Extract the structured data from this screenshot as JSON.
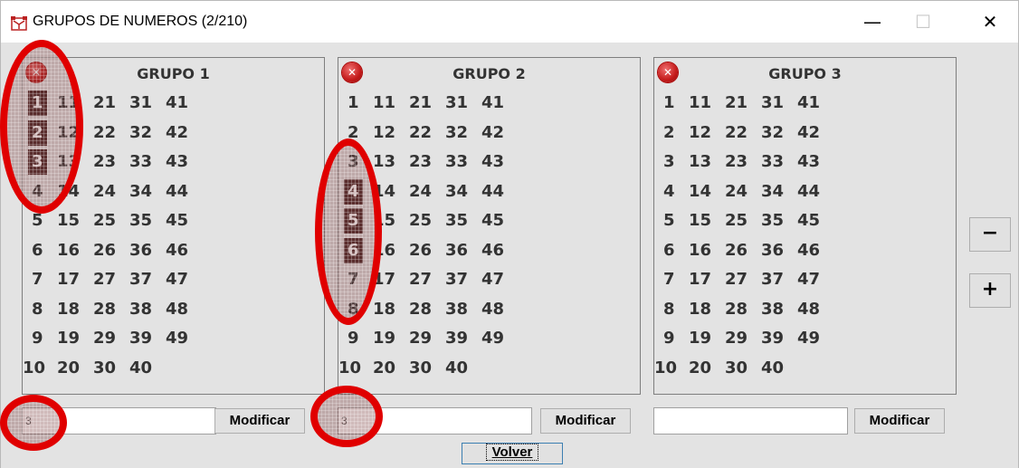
{
  "window": {
    "title": "GRUPOS DE NUMEROS (2/210)",
    "minimize": "—",
    "maximize": "☐",
    "close": "✕"
  },
  "groups": [
    {
      "title": "GRUPO 1",
      "rows": [
        [
          "1",
          "11",
          "21",
          "31",
          "41"
        ],
        [
          "2",
          "12",
          "22",
          "32",
          "42"
        ],
        [
          "3",
          "13",
          "23",
          "33",
          "43"
        ],
        [
          "4",
          "14",
          "24",
          "34",
          "44"
        ],
        [
          "5",
          "15",
          "25",
          "35",
          "45"
        ],
        [
          "6",
          "16",
          "26",
          "36",
          "46"
        ],
        [
          "7",
          "17",
          "27",
          "37",
          "47"
        ],
        [
          "8",
          "18",
          "28",
          "38",
          "48"
        ],
        [
          "9",
          "19",
          "29",
          "39",
          "49"
        ],
        [
          "10",
          "20",
          "30",
          "40"
        ]
      ],
      "selected": [
        "1",
        "2",
        "3"
      ],
      "input_value": "3",
      "button": "Modificar"
    },
    {
      "title": "GRUPO 2",
      "rows": [
        [
          "1",
          "11",
          "21",
          "31",
          "41"
        ],
        [
          "2",
          "12",
          "22",
          "32",
          "42"
        ],
        [
          "3",
          "13",
          "23",
          "33",
          "43"
        ],
        [
          "4",
          "14",
          "24",
          "34",
          "44"
        ],
        [
          "5",
          "15",
          "25",
          "35",
          "45"
        ],
        [
          "6",
          "16",
          "26",
          "36",
          "46"
        ],
        [
          "7",
          "17",
          "27",
          "37",
          "47"
        ],
        [
          "8",
          "18",
          "28",
          "38",
          "48"
        ],
        [
          "9",
          "19",
          "29",
          "39",
          "49"
        ],
        [
          "10",
          "20",
          "30",
          "40"
        ]
      ],
      "selected": [
        "4",
        "5",
        "6"
      ],
      "input_value": "3",
      "button": "Modificar"
    },
    {
      "title": "GRUPO 3",
      "rows": [
        [
          "1",
          "11",
          "21",
          "31",
          "41"
        ],
        [
          "2",
          "12",
          "22",
          "32",
          "42"
        ],
        [
          "3",
          "13",
          "23",
          "33",
          "43"
        ],
        [
          "4",
          "14",
          "24",
          "34",
          "44"
        ],
        [
          "5",
          "15",
          "25",
          "35",
          "45"
        ],
        [
          "6",
          "16",
          "26",
          "36",
          "46"
        ],
        [
          "7",
          "17",
          "27",
          "37",
          "47"
        ],
        [
          "8",
          "18",
          "28",
          "38",
          "48"
        ],
        [
          "9",
          "19",
          "29",
          "39",
          "49"
        ],
        [
          "10",
          "20",
          "30",
          "40"
        ]
      ],
      "selected": [],
      "input_value": "",
      "button": "Modificar"
    }
  ],
  "side_buttons": {
    "minus": "−",
    "plus": "+"
  },
  "volver": "Volver",
  "colors": {
    "selected_bg": "#4a2525",
    "annotation": "#e00000",
    "delete_icon": "#c41a1a"
  },
  "icons": {
    "app": "red-app-icon",
    "delete": "close-circle-icon"
  }
}
